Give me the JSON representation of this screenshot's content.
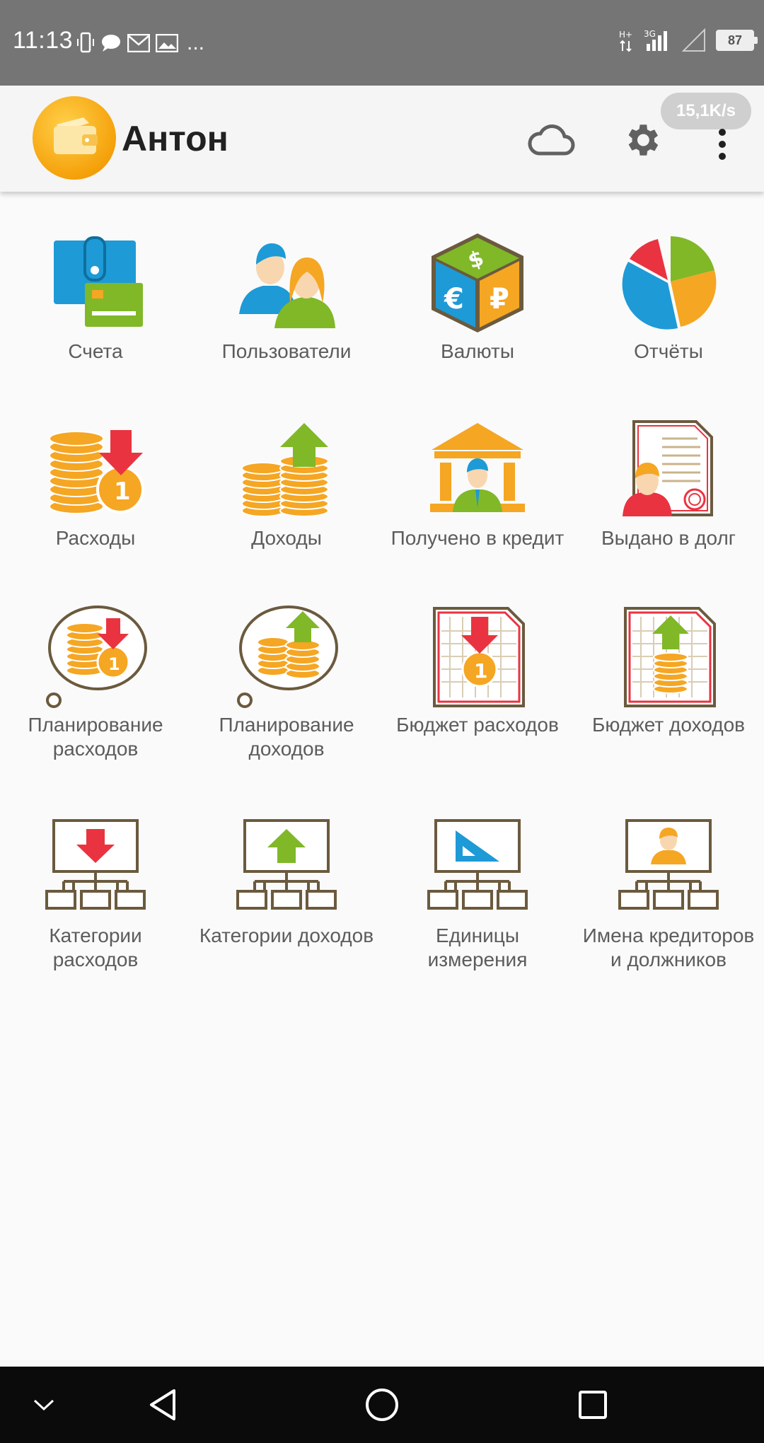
{
  "status_bar": {
    "time": "11:13",
    "battery": "87",
    "network": "3G",
    "overflow": "..."
  },
  "app_bar": {
    "title": "Антон",
    "speed": "15,1K/s",
    "icons": [
      "wallet-icon",
      "cloud-icon",
      "gear-icon",
      "more-vert-icon"
    ]
  },
  "tiles": [
    {
      "label": "Счета",
      "icon": "accounts-wallet-icon"
    },
    {
      "label": "Пользователи",
      "icon": "users-icon"
    },
    {
      "label": "Валюты",
      "icon": "currency-cube-icon"
    },
    {
      "label": "Отчёты",
      "icon": "pie-chart-icon"
    },
    {
      "label": "Расходы",
      "icon": "coins-down-arrow-icon"
    },
    {
      "label": "Доходы",
      "icon": "coins-up-arrow-icon"
    },
    {
      "label": "Получено в кредит",
      "icon": "bank-icon"
    },
    {
      "label": "Выдано в долг",
      "icon": "contract-icon"
    },
    {
      "label": "Планирование\nрасходов",
      "icon": "thought-coins-down-icon"
    },
    {
      "label": "Планирование\nдоходов",
      "icon": "thought-coins-up-icon"
    },
    {
      "label": "Бюджет расходов",
      "icon": "budget-down-icon"
    },
    {
      "label": "Бюджет доходов",
      "icon": "budget-up-icon"
    },
    {
      "label": "Категории\nрасходов",
      "icon": "category-down-icon"
    },
    {
      "label": "Категории доходов",
      "icon": "category-up-icon"
    },
    {
      "label": "Единицы\nизмерения",
      "icon": "category-ruler-icon"
    },
    {
      "label": "Имена кредиторов\nи должников",
      "icon": "category-person-icon"
    }
  ],
  "colors": {
    "accent": "#F5A10A",
    "blue": "#1E9AD6",
    "green": "#80B828",
    "red": "#EA3340",
    "orange": "#F5A623",
    "outline": "#6B5A3E"
  },
  "nav_bar": {
    "icons": [
      "chevron-down-icon",
      "back-icon",
      "home-icon",
      "recents-icon"
    ]
  }
}
